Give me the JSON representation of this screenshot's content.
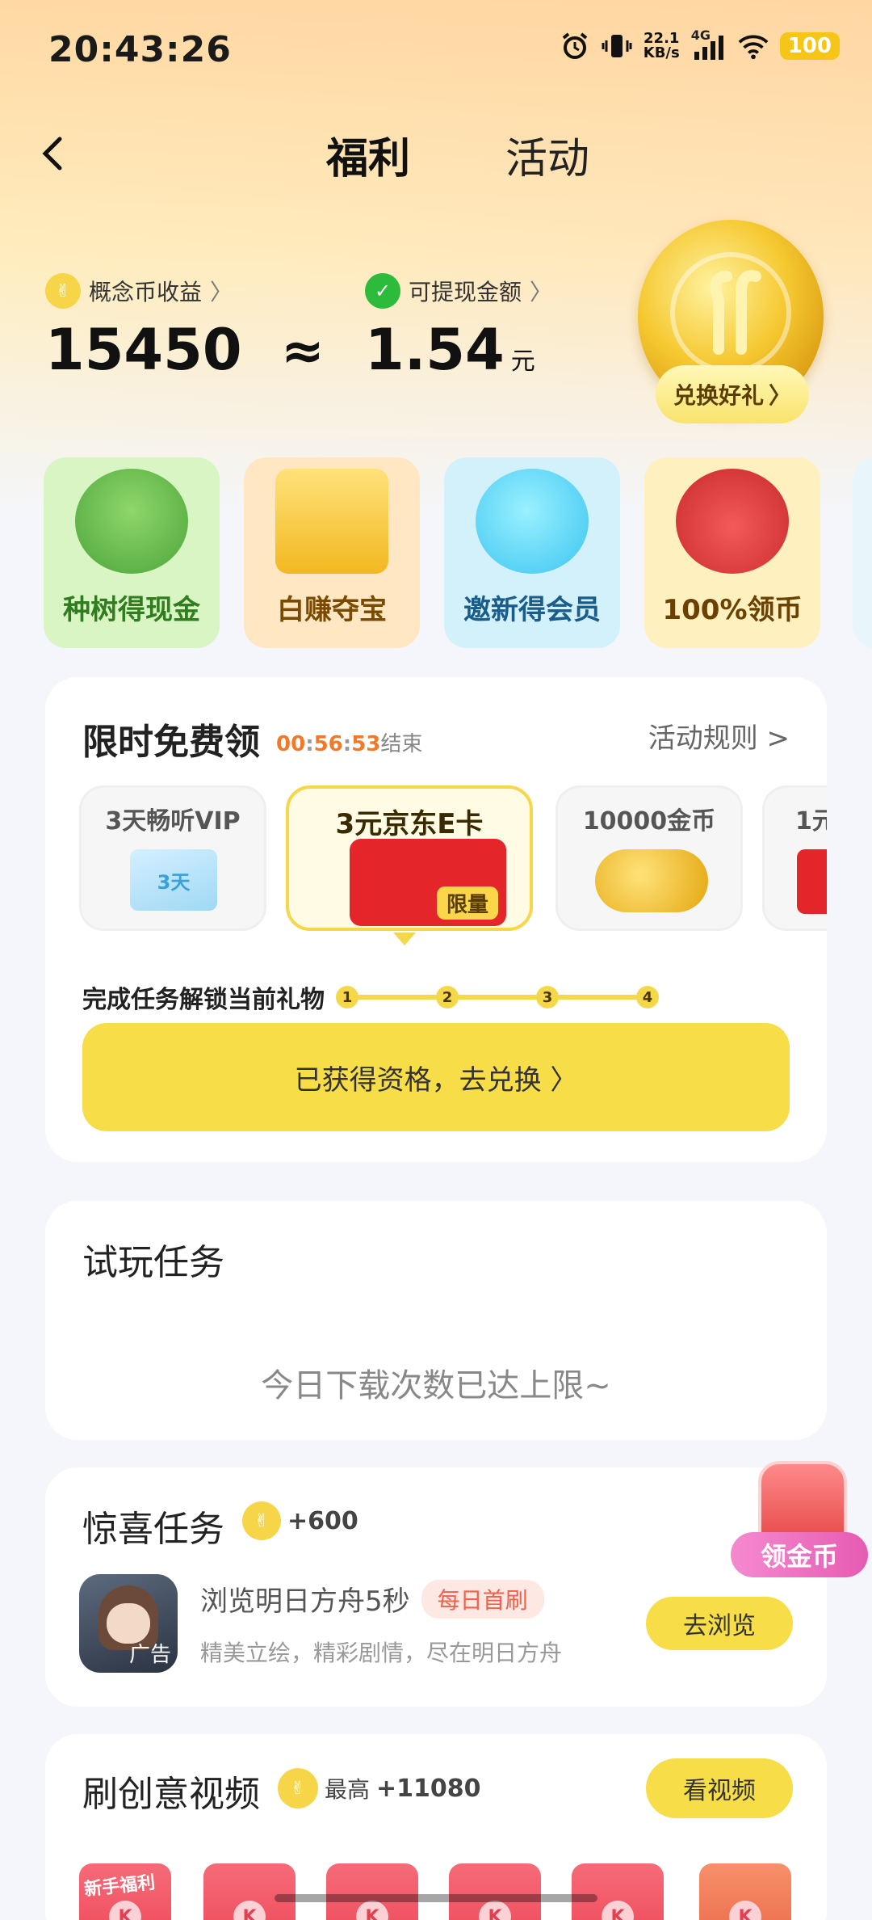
{
  "status_bar": {
    "time": "20:43:26",
    "net_speed_value": "22.1",
    "net_speed_unit": "KB/s",
    "network": "4G",
    "battery": "100"
  },
  "nav": {
    "tabs": [
      {
        "label": "福利",
        "active": true
      },
      {
        "label": "活动",
        "active": false
      }
    ]
  },
  "earnings": {
    "coin_label": "概念币收益",
    "coin_value": "15450",
    "approx": "≈",
    "cash_label": "可提现金额",
    "cash_value": "1.54",
    "cash_unit": "元",
    "redeem_label": "兑换好礼"
  },
  "features": [
    {
      "label": "种树得现金",
      "icon": "tree-icon",
      "bg": "#d9f5c4",
      "color": "#2f7d1f"
    },
    {
      "label": "白赚夺宝",
      "icon": "treasure-chest-icon",
      "bg": "#ffe7c4",
      "color": "#7a4a00"
    },
    {
      "label": "邀新得会员",
      "icon": "blue-mascot-icon",
      "bg": "#d3f1fb",
      "color": "#1a5c8a"
    },
    {
      "label": "100%领币",
      "icon": "lucky-bag-icon",
      "bg": "#fff0bf",
      "color": "#6b4000"
    }
  ],
  "limited": {
    "title": "限时免费领",
    "countdown_h": "00",
    "countdown_m": "56",
    "countdown_s": "53",
    "countdown_end": "结束",
    "rules": "活动规则 >",
    "gifts": [
      {
        "name": "3天畅听VIP",
        "thumb": "3天"
      },
      {
        "name": "3元京东E卡",
        "tag": "限量",
        "selected": true
      },
      {
        "name": "10000金币"
      },
      {
        "name": "1元"
      }
    ],
    "steps_label": "完成任务解锁当前礼物",
    "steps": [
      "1",
      "2",
      "3",
      "4"
    ],
    "cta": "已获得资格，去兑换 〉"
  },
  "trial": {
    "title": "试玩任务",
    "message": "今日下载次数已达上限~"
  },
  "surprise": {
    "title": "惊喜任务",
    "reward": "+600",
    "task_title": "浏览明日方舟5秒",
    "task_tag": "每日首刷",
    "task_desc": "精美立绘，精彩剧情，尽在明日方舟",
    "ad_tag": "广告",
    "button": "去浏览"
  },
  "float_widget": {
    "label": "领金币"
  },
  "creative": {
    "title": "刷创意视频",
    "reward_prefix": "最高",
    "reward": "+11080",
    "button": "看视频",
    "first_tag": "新手福利",
    "packet_letter": "K"
  }
}
